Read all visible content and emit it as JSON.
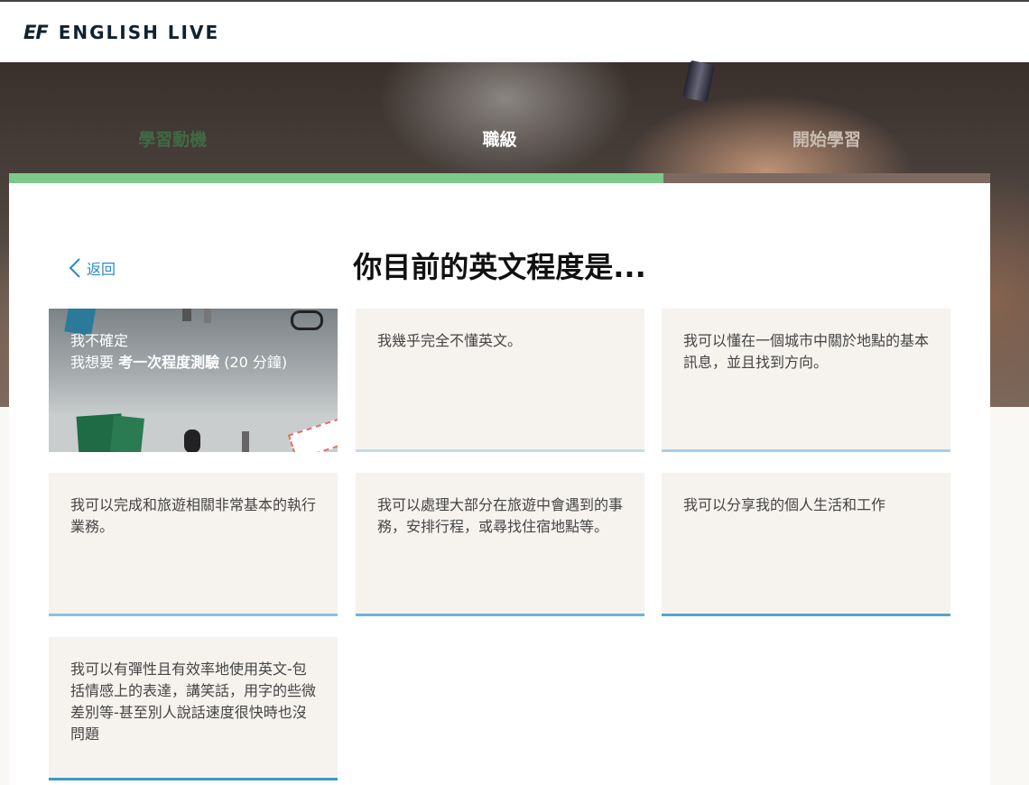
{
  "brand": {
    "mark": "EF",
    "name": "ENGLISH LIVE"
  },
  "steps": [
    {
      "label": "學習動機",
      "state": "done"
    },
    {
      "label": "職級",
      "state": "current"
    },
    {
      "label": "開始學習",
      "state": "upcoming"
    }
  ],
  "progress": {
    "fraction": 0.667
  },
  "nav": {
    "back_label": "返回"
  },
  "page": {
    "title": "你目前的英文程度是..."
  },
  "placement_card": {
    "line1": "我不確定",
    "line2_prefix": "我想要 ",
    "line2_bold": "考一次程度測驗",
    "line2_suffix": " (20 分鐘)"
  },
  "levels": [
    {
      "text": "我幾乎完全不懂英文。",
      "accent_level": 1
    },
    {
      "text": "我可以懂在一個城市中關於地點的基本訊息，並且找到方向。",
      "accent_level": 2
    },
    {
      "text": "我可以完成和旅遊相關非常基本的執行業務。",
      "accent_level": 3
    },
    {
      "text": "我可以處理大部分在旅遊中會遇到的事務，安排行程，或尋找住宿地點等。",
      "accent_level": 4
    },
    {
      "text": "我可以分享我的個人生活和工作",
      "accent_level": 5
    },
    {
      "text": "我可以有彈性且有效率地使用英文-包括情感上的表達，講笑話，用字的些微差別等-甚至別人說話速度很快時也沒問題",
      "accent_level": 6
    }
  ],
  "colors": {
    "progress_fill": "#7cc98a",
    "progress_track": "#7e6a61",
    "link": "#2d8bc0",
    "card_bg": "#f6f3ef",
    "accent_scale": [
      "#c3dced",
      "#a6cfe6",
      "#8bc1df",
      "#6fb3d7",
      "#54a5cf",
      "#3a98c8"
    ]
  }
}
